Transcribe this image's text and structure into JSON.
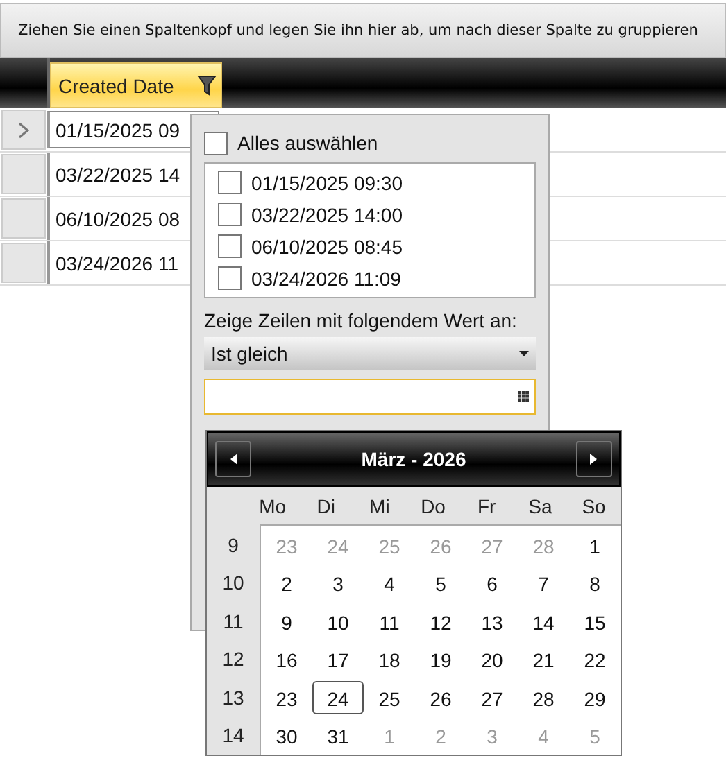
{
  "group_panel": {
    "hint": "Ziehen Sie einen Spaltenkopf und legen Sie ihn hier ab, um nach dieser Spalte zu gruppieren"
  },
  "grid": {
    "columns": [
      {
        "label": "Created Date",
        "filter_active": true
      }
    ],
    "rows": [
      {
        "current": true,
        "cells": [
          "01/15/2025 09"
        ]
      },
      {
        "current": false,
        "cells": [
          "03/22/2025 14"
        ]
      },
      {
        "current": false,
        "cells": [
          "06/10/2025 08"
        ]
      },
      {
        "current": false,
        "cells": [
          "03/24/2026 11"
        ]
      }
    ]
  },
  "filter_popup": {
    "select_all": {
      "label": "Alles auswählen",
      "checked": false
    },
    "values": [
      {
        "label": "01/15/2025 09:30",
        "checked": false
      },
      {
        "label": "03/22/2025 14:00",
        "checked": false
      },
      {
        "label": "06/10/2025 08:45",
        "checked": false
      },
      {
        "label": "03/24/2026 11:09",
        "checked": false
      }
    ],
    "condition_label": "Zeige Zeilen mit folgendem Wert an:",
    "operator": "Ist gleich"
  },
  "calendar": {
    "title": "März - 2026",
    "weekdays": [
      "Mo",
      "Di",
      "Mi",
      "Do",
      "Fr",
      "Sa",
      "So"
    ],
    "weeks": [
      {
        "week": "9",
        "days": [
          {
            "day": "23",
            "in_month": false,
            "selected": false
          },
          {
            "day": "24",
            "in_month": false,
            "selected": false
          },
          {
            "day": "25",
            "in_month": false,
            "selected": false
          },
          {
            "day": "26",
            "in_month": false,
            "selected": false
          },
          {
            "day": "27",
            "in_month": false,
            "selected": false
          },
          {
            "day": "28",
            "in_month": false,
            "selected": false
          },
          {
            "day": "1",
            "in_month": true,
            "selected": false
          }
        ]
      },
      {
        "week": "10",
        "days": [
          {
            "day": "2",
            "in_month": true,
            "selected": false
          },
          {
            "day": "3",
            "in_month": true,
            "selected": false
          },
          {
            "day": "4",
            "in_month": true,
            "selected": false
          },
          {
            "day": "5",
            "in_month": true,
            "selected": false
          },
          {
            "day": "6",
            "in_month": true,
            "selected": false
          },
          {
            "day": "7",
            "in_month": true,
            "selected": false
          },
          {
            "day": "8",
            "in_month": true,
            "selected": false
          }
        ]
      },
      {
        "week": "11",
        "days": [
          {
            "day": "9",
            "in_month": true,
            "selected": false
          },
          {
            "day": "10",
            "in_month": true,
            "selected": false
          },
          {
            "day": "11",
            "in_month": true,
            "selected": false
          },
          {
            "day": "12",
            "in_month": true,
            "selected": false
          },
          {
            "day": "13",
            "in_month": true,
            "selected": false
          },
          {
            "day": "14",
            "in_month": true,
            "selected": false
          },
          {
            "day": "15",
            "in_month": true,
            "selected": false
          }
        ]
      },
      {
        "week": "12",
        "days": [
          {
            "day": "16",
            "in_month": true,
            "selected": false
          },
          {
            "day": "17",
            "in_month": true,
            "selected": false
          },
          {
            "day": "18",
            "in_month": true,
            "selected": false
          },
          {
            "day": "19",
            "in_month": true,
            "selected": false
          },
          {
            "day": "20",
            "in_month": true,
            "selected": false
          },
          {
            "day": "21",
            "in_month": true,
            "selected": false
          },
          {
            "day": "22",
            "in_month": true,
            "selected": false
          }
        ]
      },
      {
        "week": "13",
        "days": [
          {
            "day": "23",
            "in_month": true,
            "selected": false
          },
          {
            "day": "24",
            "in_month": true,
            "selected": true
          },
          {
            "day": "25",
            "in_month": true,
            "selected": false
          },
          {
            "day": "26",
            "in_month": true,
            "selected": false
          },
          {
            "day": "27",
            "in_month": true,
            "selected": false
          },
          {
            "day": "28",
            "in_month": true,
            "selected": false
          },
          {
            "day": "29",
            "in_month": true,
            "selected": false
          }
        ]
      },
      {
        "week": "14",
        "days": [
          {
            "day": "30",
            "in_month": true,
            "selected": false
          },
          {
            "day": "31",
            "in_month": true,
            "selected": false
          },
          {
            "day": "1",
            "in_month": false,
            "selected": false
          },
          {
            "day": "2",
            "in_month": false,
            "selected": false
          },
          {
            "day": "3",
            "in_month": false,
            "selected": false
          },
          {
            "day": "4",
            "in_month": false,
            "selected": false
          },
          {
            "day": "5",
            "in_month": false,
            "selected": false
          }
        ]
      }
    ]
  }
}
